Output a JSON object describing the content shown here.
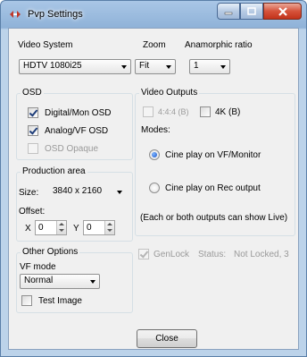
{
  "window": {
    "title": "Pvp Settings"
  },
  "video_system": {
    "label": "Video System",
    "value": "HDTV 1080i25"
  },
  "zoom": {
    "label": "Zoom",
    "value": "Fit"
  },
  "anamorphic": {
    "label": "Anamorphic ratio",
    "value": "1"
  },
  "osd": {
    "title": "OSD",
    "digital": {
      "label": "Digital/Mon OSD",
      "checked": true
    },
    "analog": {
      "label": "Analog/VF OSD",
      "checked": true
    },
    "opaque": {
      "label": "OSD Opaque",
      "checked": false,
      "disabled": true
    }
  },
  "video_outputs": {
    "title": "Video Outputs",
    "opt444": {
      "label": "4:4:4 (B)",
      "checked": false,
      "disabled": true
    },
    "opt4k": {
      "label": "4K (B)",
      "checked": false
    },
    "modes_label": "Modes:",
    "mode_vf": {
      "label": "Cine play on VF/Monitor",
      "selected": true
    },
    "mode_rec": {
      "label": "Cine play on Rec output",
      "selected": false
    },
    "note": "(Each or both outputs can show Live)"
  },
  "production_area": {
    "title": "Production area",
    "size_label": "Size:",
    "size_value": "3840 x 2160",
    "offset_label": "Offset:",
    "x_label": "X",
    "x_value": "0",
    "y_label": "Y",
    "y_value": "0"
  },
  "other_options": {
    "title": "Other Options",
    "vf_mode_label": "VF mode",
    "vf_mode_value": "Normal",
    "test_image": {
      "label": "Test Image",
      "checked": false
    }
  },
  "genlock": {
    "label": "GenLock",
    "checked": true,
    "disabled": true,
    "status_label": "Status:",
    "status_value": "Not Locked, 3"
  },
  "buttons": {
    "close": "Close"
  }
}
